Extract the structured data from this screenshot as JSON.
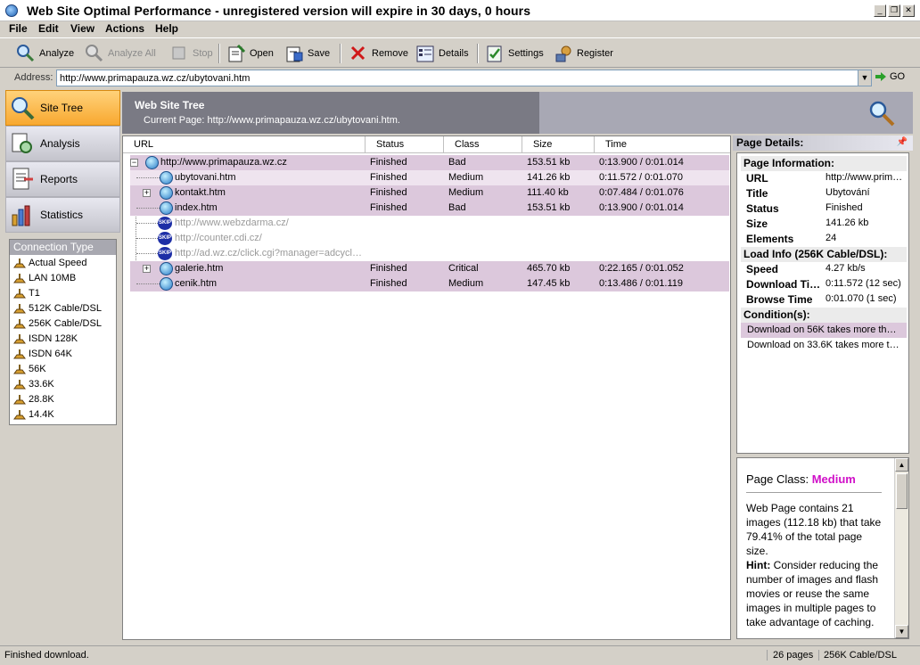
{
  "window": {
    "title": "Web Site Optimal Performance - unregistered version will expire in 30 days, 0 hours"
  },
  "menu": [
    "File",
    "Edit",
    "View",
    "Actions",
    "Help"
  ],
  "toolbar": {
    "analyze": "Analyze",
    "analyze_all": "Analyze All",
    "stop": "Stop",
    "open": "Open",
    "save": "Save",
    "remove": "Remove",
    "details": "Details",
    "settings": "Settings",
    "register": "Register"
  },
  "address": {
    "label": "Address:",
    "value": "http://www.primapauza.wz.cz/ubytovani.htm",
    "go": "GO"
  },
  "sidebar": {
    "items": [
      {
        "label": "Site Tree",
        "icon": "site-tree-icon",
        "active": true
      },
      {
        "label": "Analysis",
        "icon": "analysis-icon",
        "active": false
      },
      {
        "label": "Reports",
        "icon": "reports-icon",
        "active": false
      },
      {
        "label": "Statistics",
        "icon": "statistics-icon",
        "active": false
      }
    ],
    "connection_title": "Connection Type",
    "connections": [
      "Actual Speed",
      "LAN 10MB",
      "T1",
      "512K Cable/DSL",
      "256K Cable/DSL",
      "ISDN 128K",
      "ISDN 64K",
      "56K",
      "33.6K",
      "28.8K",
      "14.4K"
    ]
  },
  "main": {
    "title": "Web Site Tree",
    "current_page": "Current Page: http://www.primapauza.wz.cz/ubytovani.htm."
  },
  "tree": {
    "columns": [
      "URL",
      "Status",
      "Class",
      "Size",
      "Time"
    ],
    "rows": [
      {
        "url": "http://www.primapauza.wz.cz",
        "status": "Finished",
        "class": "Bad",
        "size": "153.51 kb",
        "time": "0:13.900 / 0:01.014"
      },
      {
        "url": "ubytovani.htm",
        "status": "Finished",
        "class": "Medium",
        "size": "141.26 kb",
        "time": "0:11.572 / 0:01.070"
      },
      {
        "url": "kontakt.htm",
        "status": "Finished",
        "class": "Medium",
        "size": "111.40 kb",
        "time": "0:07.484 / 0:01.076"
      },
      {
        "url": "index.htm",
        "status": "Finished",
        "class": "Bad",
        "size": "153.51 kb",
        "time": "0:13.900 / 0:01.014"
      },
      {
        "url": "http://www.webzdarma.cz/",
        "status": "",
        "class": "",
        "size": "",
        "time": ""
      },
      {
        "url": "http://counter.cdi.cz/",
        "status": "",
        "class": "",
        "size": "",
        "time": ""
      },
      {
        "url": "http://ad.wz.cz/click.cgi?manager=adcycl…",
        "status": "",
        "class": "",
        "size": "",
        "time": ""
      },
      {
        "url": "galerie.htm",
        "status": "Finished",
        "class": "Critical",
        "size": "465.70 kb",
        "time": "0:22.165 / 0:01.052"
      },
      {
        "url": "cenik.htm",
        "status": "Finished",
        "class": "Medium",
        "size": "147.45 kb",
        "time": "0:13.486 / 0:01.119"
      }
    ],
    "skip_label": "SKIP"
  },
  "details": {
    "title": "Page Details:",
    "page_info_title": "Page Information:",
    "page_info": [
      {
        "key": "URL",
        "value": "http://www.prim…"
      },
      {
        "key": "Title",
        "value": "Ubytování"
      },
      {
        "key": "Status",
        "value": "Finished"
      },
      {
        "key": "Size",
        "value": "141.26 kb"
      },
      {
        "key": "Elements",
        "value": "24"
      }
    ],
    "load_info_title": "Load Info (256K Cable/DSL):",
    "load_info": [
      {
        "key": "Speed",
        "value": "4.27 kb/s"
      },
      {
        "key": "Download Ti…",
        "value": "0:11.572 (12 sec)"
      },
      {
        "key": "Browse Time",
        "value": "0:01.070 (1 sec)"
      }
    ],
    "conditions_title": "Condition(s):",
    "conditions": [
      "Download on 56K takes more than …",
      "Download on 33.6K takes more tha…"
    ],
    "class_label": "Page Class:",
    "class_value": "Medium",
    "class_text": "Web Page contains 21 images (112.18 kb) that take 79.41% of the total page size.",
    "hint_label": "Hint:",
    "hint_text": "Consider reducing the number of images and flash movies or reuse the same images in multiple pages to take advantage of caching."
  },
  "status": {
    "text": "Finished download.",
    "pages": "26 pages",
    "connection": "256K Cable/DSL"
  },
  "colors": {
    "class_medium": "#d010c8",
    "row_highlight": "#dcc8dc",
    "sidebar_active": "#f8a830"
  }
}
